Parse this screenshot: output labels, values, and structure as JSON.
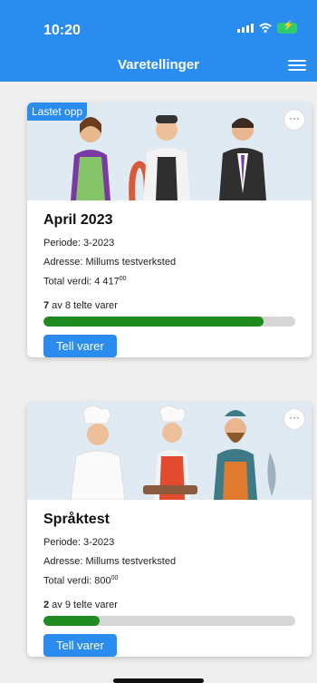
{
  "status_bar": {
    "time": "10:20"
  },
  "header": {
    "title": "Varetellinger"
  },
  "cards": [
    {
      "badge": "Lastet opp",
      "title": "April 2023",
      "period_label": "Periode: ",
      "period_value": "3-2023",
      "address_label": "Adresse: ",
      "address_value": "Millums testverksted",
      "total_label": "Total verdi: ",
      "total_value": "4 417",
      "total_cents": "00",
      "count_done": "7",
      "count_text": " av 8 telte varer",
      "progress": 0.875,
      "button_label": "Tell varer"
    },
    {
      "title": "Språktest",
      "period_label": "Periode: ",
      "period_value": "3-2023",
      "address_label": "Adresse: ",
      "address_value": "Millums testverksted",
      "total_label": "Total verdi: ",
      "total_value": "800",
      "total_cents": "00",
      "count_done": "2",
      "count_text": " av 9 telte varer",
      "progress": 0.222,
      "button_label": "Tell varer"
    }
  ],
  "colors": {
    "primary": "#2b8cf0",
    "progress": "#1f8a1f",
    "track": "#d6d6d6"
  }
}
